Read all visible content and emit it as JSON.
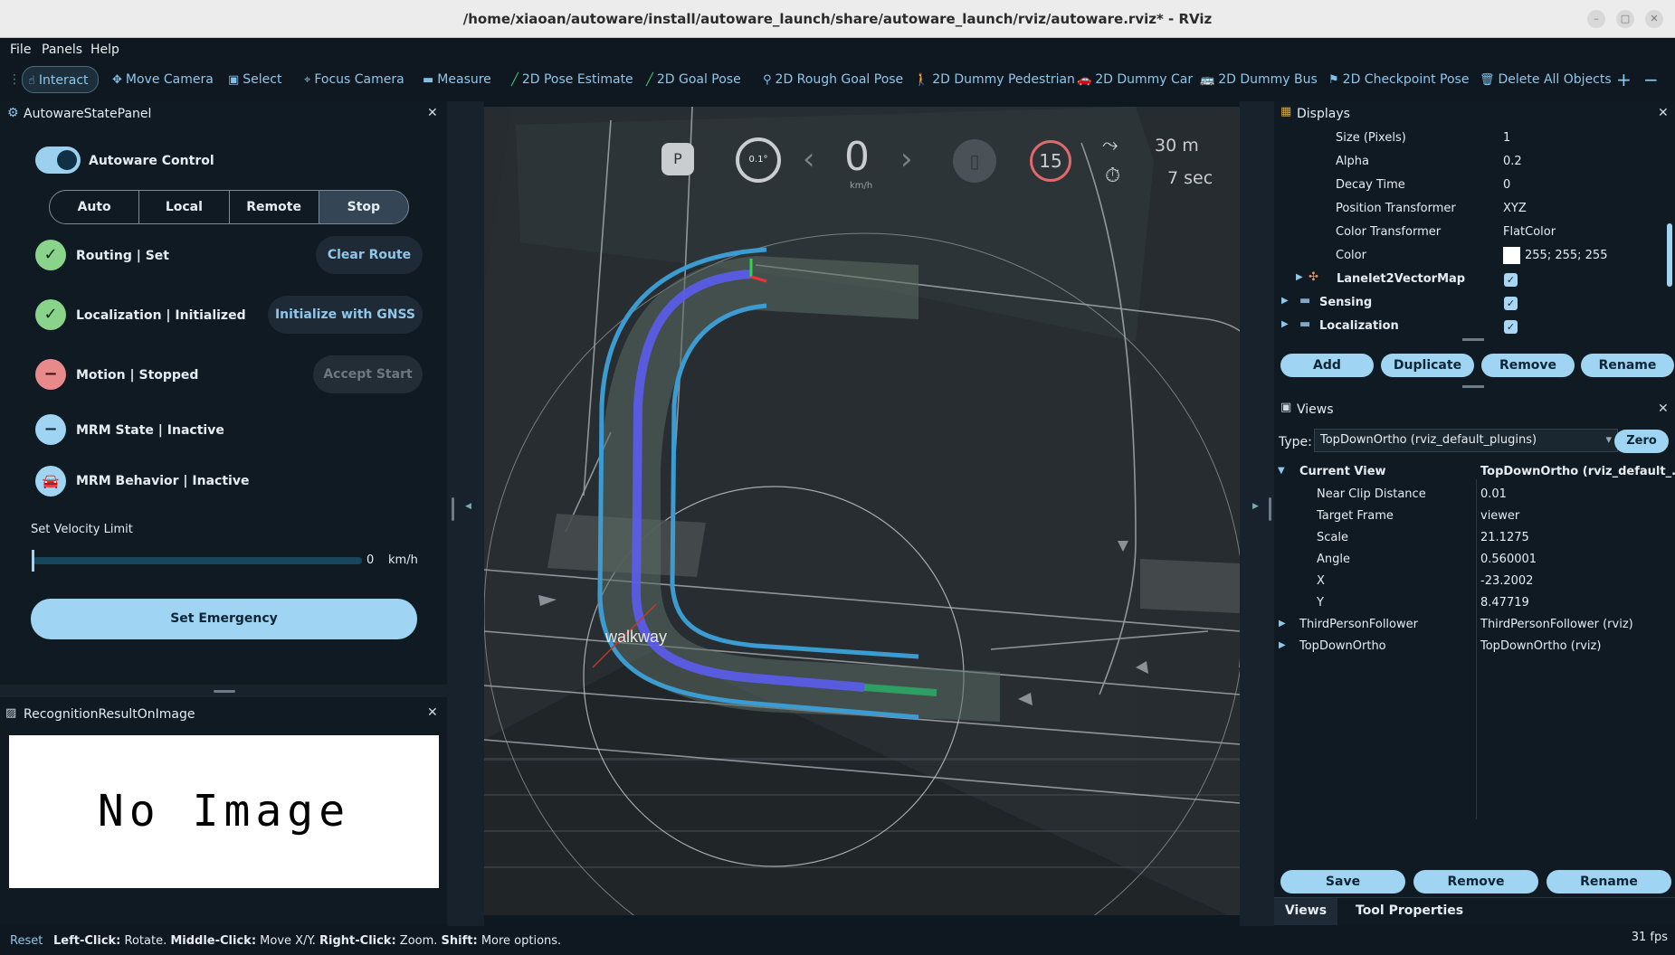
{
  "window": {
    "title": "/home/xiaoan/autoware/install/autoware_launch/share/autoware_launch/rviz/autoware.rviz* - RViz"
  },
  "menu": [
    "File",
    "Panels",
    "Help"
  ],
  "toolbar": [
    {
      "label": "Interact",
      "icon": "hand-pointer-icon"
    },
    {
      "label": "Move Camera",
      "icon": "move-camera-icon"
    },
    {
      "label": "Select",
      "icon": "select-icon"
    },
    {
      "label": "Focus Camera",
      "icon": "focus-camera-icon"
    },
    {
      "label": "Measure",
      "icon": "ruler-icon"
    },
    {
      "label": "2D Pose Estimate",
      "icon": "pose-arrow-icon"
    },
    {
      "label": "2D Goal Pose",
      "icon": "goal-arrow-icon"
    },
    {
      "label": "2D Rough Goal Pose",
      "icon": "map-pin-icon"
    },
    {
      "label": "2D Dummy Pedestrian",
      "icon": "pedestrian-icon"
    },
    {
      "label": "2D Dummy Car",
      "icon": "car-icon"
    },
    {
      "label": "2D Dummy Bus",
      "icon": "bus-icon"
    },
    {
      "label": "2D Checkpoint Pose",
      "icon": "flag-icon"
    },
    {
      "label": "Delete All Objects",
      "icon": "trash-icon"
    }
  ],
  "state_panel": {
    "title": "AutowareStatePanel",
    "control_label": "Autoware Control",
    "modes": [
      "Auto",
      "Local",
      "Remote",
      "Stop"
    ],
    "routing": "Routing | Set",
    "clear_route": "Clear Route",
    "localization": "Localization | Initialized",
    "init_gnss": "Initialize with GNSS",
    "motion": "Motion | Stopped",
    "accept_start": "Accept Start",
    "mrm_state": "MRM State | Inactive",
    "mrm_behavior": "MRM Behavior | Inactive",
    "velocity_label": "Set Velocity Limit",
    "velocity_value": "0",
    "velocity_unit": "km/h",
    "emergency": "Set Emergency"
  },
  "recognition": {
    "title": "RecognitionResultOnImage",
    "no_image": "No Image"
  },
  "hud": {
    "gear": "P",
    "steer": "0.1°",
    "speed": "0",
    "speed_unit": "km/h",
    "limit": "15",
    "distance": "30 m",
    "time": "7 sec"
  },
  "scene": {
    "label": "walkway"
  },
  "displays": {
    "title": "Displays",
    "rows": [
      {
        "k": "Size (Pixels)",
        "v": "1"
      },
      {
        "k": "Alpha",
        "v": "0.2"
      },
      {
        "k": "Decay Time",
        "v": "0"
      },
      {
        "k": "Position Transformer",
        "v": "XYZ"
      },
      {
        "k": "Color Transformer",
        "v": "FlatColor"
      },
      {
        "k": "Color",
        "v": "255; 255; 255"
      }
    ],
    "items": [
      "Lanelet2VectorMap",
      "Sensing",
      "Localization"
    ],
    "buttons": [
      "Add",
      "Duplicate",
      "Remove",
      "Rename"
    ]
  },
  "views": {
    "title": "Views",
    "type_label": "Type:",
    "type_value": "TopDownOrtho (rviz_default_plugins)",
    "zero": "Zero",
    "current_view": "Current View",
    "current_view_value": "TopDownOrtho (rviz_default_...",
    "rows": [
      {
        "k": "Near Clip Distance",
        "v": "0.01"
      },
      {
        "k": "Target Frame",
        "v": "viewer"
      },
      {
        "k": "Scale",
        "v": "21.1275"
      },
      {
        "k": "Angle",
        "v": "0.560001"
      },
      {
        "k": "X",
        "v": "-23.2002"
      },
      {
        "k": "Y",
        "v": "8.47719"
      }
    ],
    "others": [
      {
        "k": "ThirdPersonFollower",
        "v": "ThirdPersonFollower (rviz)"
      },
      {
        "k": "TopDownOrtho",
        "v": "TopDownOrtho (rviz)"
      }
    ],
    "buttons": [
      "Save",
      "Remove",
      "Rename"
    ],
    "tabs": [
      "Views",
      "Tool Properties"
    ]
  },
  "status": {
    "reset": "Reset",
    "help_parts": [
      "Left-Click:",
      " Rotate. ",
      "Middle-Click:",
      " Move X/Y. ",
      "Right-Click:",
      " Zoom. ",
      "Shift:",
      " More options."
    ],
    "fps": "31 fps"
  }
}
